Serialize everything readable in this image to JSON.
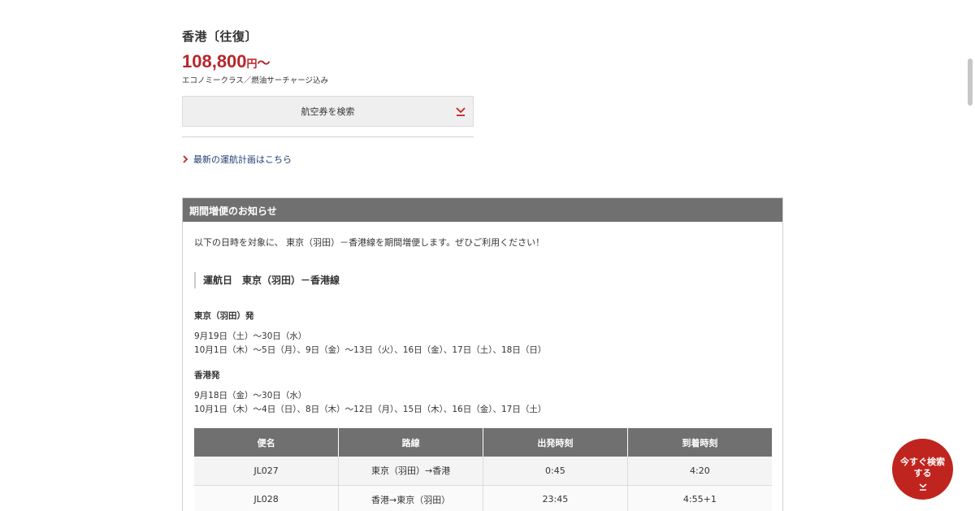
{
  "destination": {
    "title": "香港〔往復〕",
    "price_number": "108,800",
    "price_unit": "円",
    "price_suffix": "～",
    "price_note": "エコノミークラス／燃油サーチャージ込み"
  },
  "search_button": {
    "label": "航空券を検索",
    "icon": "chevron-down-icon"
  },
  "schedule_link": {
    "label": "最新の運航計画はこちら",
    "icon": "chevron-right-icon"
  },
  "notice": {
    "title": "期間増便のお知らせ",
    "intro": "以下の日時を対象に、 東京（羽田）－香港線を期間増便します。ぜひご利用ください！",
    "section_title": "運航日　東京（羽田）－香港線",
    "departures": [
      {
        "title": "東京（羽田）発",
        "lines": [
          "9月19日（土）～30日（水）",
          "10月1日（木）～5日（月）、9日（金）～13日（火）、16日（金）、17日（土）、18日（日）"
        ]
      },
      {
        "title": "香港発",
        "lines": [
          "9月18日（金）～30日（水）",
          "10月1日（木）～4日（日）、8日（木）～12日（月）、15日（木）、16日（金）、17日（土）"
        ]
      }
    ],
    "table": {
      "headers": [
        "便名",
        "路線",
        "出発時刻",
        "到着時刻"
      ],
      "rows": [
        [
          "JL027",
          "東京（羽田）→香港",
          "0:45",
          "4:20"
        ],
        [
          "JL028",
          "香港→東京（羽田）",
          "23:45",
          "4:55+1"
        ]
      ]
    }
  },
  "floating_button": {
    "line1": "今すぐ検索",
    "line2": "する",
    "icon": "chevron-down-icon"
  },
  "colors": {
    "price_red": "#b5262b",
    "header_gray": "#707070",
    "link_navy": "#1e3d73",
    "fab_red": "#c0241f"
  }
}
